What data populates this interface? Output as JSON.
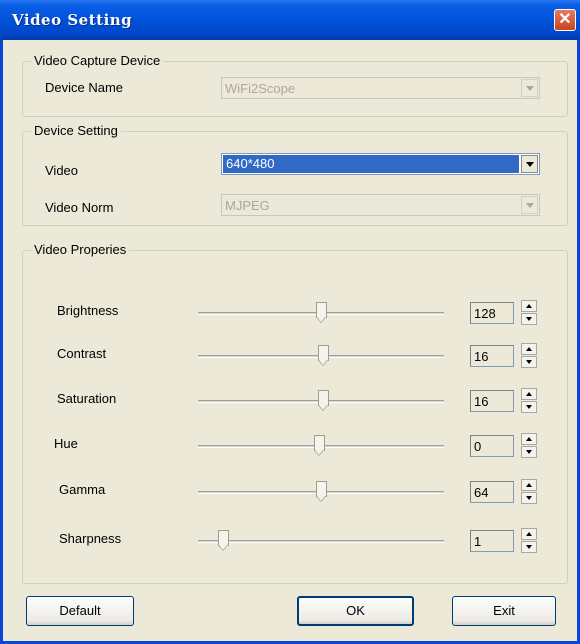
{
  "window": {
    "title": "Video Setting",
    "close_glyph": "✕"
  },
  "capture_group": {
    "title": "Video Capture Device",
    "device_name_label": "Device Name",
    "device_name_value": "WiFi2Scope"
  },
  "device_group": {
    "title": "Device Setting",
    "video_label": "Video",
    "video_value": "640*480",
    "norm_label": "Video Norm",
    "norm_value": "MJPEG"
  },
  "props_group": {
    "title": "Video Properies",
    "sliders": [
      {
        "label": "Brightness",
        "value": "128",
        "level": 0.5
      },
      {
        "label": "Contrast",
        "value": "16",
        "level": 0.51
      },
      {
        "label": "Saturation",
        "value": "16",
        "level": 0.51
      },
      {
        "label": "Hue",
        "value": "0",
        "level": 0.49
      },
      {
        "label": "Gamma",
        "value": "64",
        "level": 0.5
      },
      {
        "label": "Sharpness",
        "value": "1",
        "level": 0.1
      }
    ]
  },
  "buttons": {
    "default": "Default",
    "ok": "OK",
    "exit": "Exit"
  }
}
